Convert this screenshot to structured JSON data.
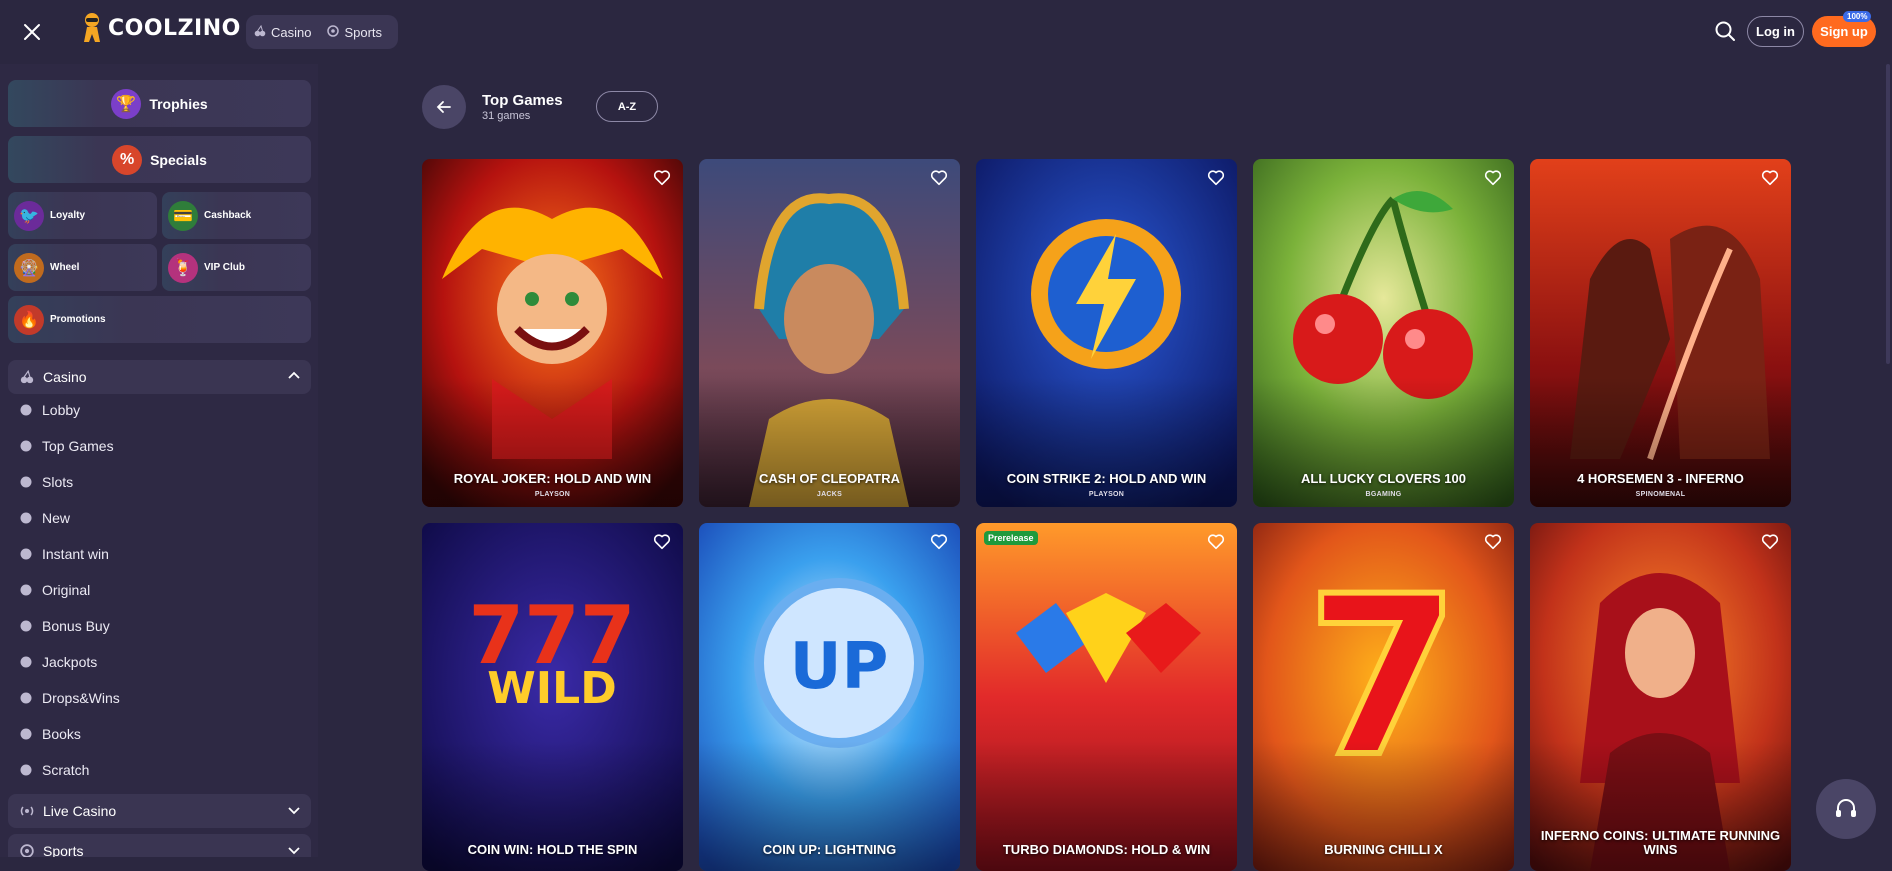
{
  "header": {
    "brand": "COOLZINO",
    "nav": [
      {
        "label": "Casino",
        "icon": "cherry-icon"
      },
      {
        "label": "Sports",
        "icon": "ball-icon"
      }
    ],
    "login_label": "Log in",
    "signup_label": "Sign up",
    "signup_badge": "100%"
  },
  "sidebar": {
    "promos_wide": [
      {
        "label": "Trophies",
        "icon": "trophy-icon"
      },
      {
        "label": "Specials",
        "icon": "percent-icon"
      }
    ],
    "promos_small": [
      {
        "label": "Loyalty",
        "icon": "bird-icon"
      },
      {
        "label": "Cashback",
        "icon": "wallet-icon"
      },
      {
        "label": "Wheel",
        "icon": "wheel-icon"
      },
      {
        "label": "VIP Club",
        "icon": "cocktail-icon"
      },
      {
        "label": "Promotions",
        "icon": "fire-icon"
      }
    ],
    "casino_section": "Casino",
    "casino_items": [
      {
        "label": "Lobby",
        "icon": "lobby-icon"
      },
      {
        "label": "Top Games",
        "icon": "flame-icon"
      },
      {
        "label": "Slots",
        "icon": "slot-icon"
      },
      {
        "label": "New",
        "icon": "star-icon"
      },
      {
        "label": "Instant win",
        "icon": "lightning-icon"
      },
      {
        "label": "Original",
        "icon": "rocket-icon"
      },
      {
        "label": "Bonus Buy",
        "icon": "medal-icon"
      },
      {
        "label": "Jackpots",
        "icon": "coin-icon"
      },
      {
        "label": "Drops&Wins",
        "icon": "drops-icon"
      },
      {
        "label": "Books",
        "icon": "book-icon"
      },
      {
        "label": "Scratch",
        "icon": "scratch-icon"
      }
    ],
    "live_section": "Live Casino",
    "sports_section": "Sports"
  },
  "page": {
    "title": "Top Games",
    "subtitle": "31 games",
    "sort_label": "A-Z"
  },
  "games": [
    {
      "title": "Royal Joker: Hold and Win",
      "provider": "PLAYSON"
    },
    {
      "title": "Cash of Cleopatra",
      "provider": "JACKS"
    },
    {
      "title": "Coin Strike 2: Hold and Win",
      "provider": "PLAYSON"
    },
    {
      "title": "All Lucky Clovers 100",
      "provider": "BGAMING"
    },
    {
      "title": "4 Horsemen 3 - Inferno",
      "provider": "SPINOMENAL"
    },
    {
      "title": "Coin Win: Hold The Spin",
      "provider": ""
    },
    {
      "title": "Coin Up: Lightning",
      "provider": ""
    },
    {
      "title": "Turbo Diamonds: Hold & Win",
      "provider": "",
      "badge": "Prerelease"
    },
    {
      "title": "Burning Chilli X",
      "provider": ""
    },
    {
      "title": "Inferno Coins: Ultimate Running Wins",
      "provider": ""
    }
  ],
  "colors": {
    "background": "#2b2740",
    "sidebar": "#2e2944",
    "accent_orange": "#ff6a1f",
    "badge_blue": "#3a6be8",
    "prerelease_green": "#1f9a3c"
  }
}
